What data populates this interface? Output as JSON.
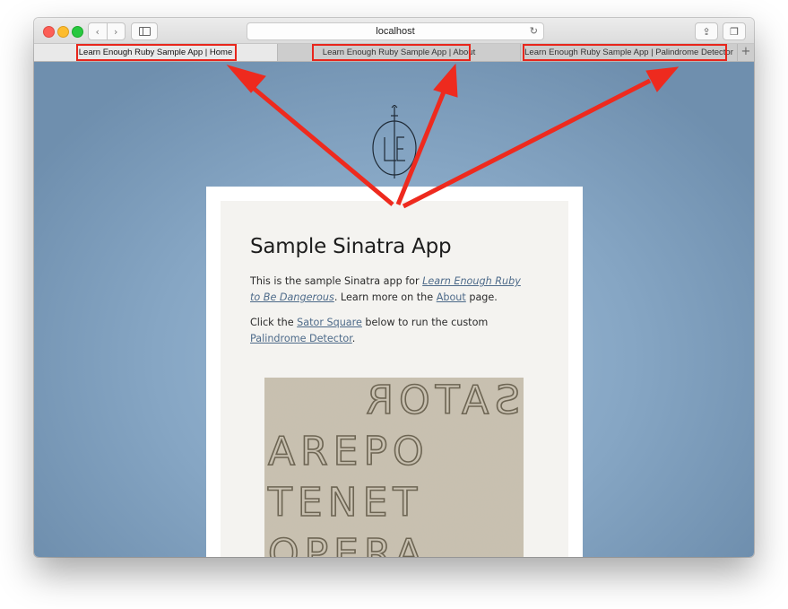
{
  "browser": {
    "url": "localhost",
    "tabs": [
      {
        "title": "Learn Enough Ruby Sample App | Home",
        "active": true
      },
      {
        "title": "Learn Enough Ruby Sample App | About",
        "active": false
      },
      {
        "title": "Learn Enough Ruby Sample App | Palindrome Detector",
        "active": false
      }
    ],
    "new_tab_label": "+"
  },
  "page": {
    "title": "Sample Sinatra App",
    "intro": {
      "prefix": "This is the sample Sinatra app for ",
      "book_link": "Learn Enough Ruby to Be Dangerous",
      "middle": ". Learn more on the ",
      "about_link": "About",
      "suffix": " page."
    },
    "cta": {
      "prefix": "Click the ",
      "sator_link": "Sator Square",
      "middle": " below to run the custom ",
      "palindrome_link": "Palindrome Detector",
      "suffix": "."
    },
    "sator_rows": [
      "SATOR",
      "AREPO",
      "TENET",
      "OPERA"
    ]
  },
  "colors": {
    "annotation": "#e8261c",
    "link": "#4e6b8a",
    "background": "#86a6c4"
  },
  "icons": [
    "back-icon",
    "forward-icon",
    "sidebar-icon",
    "reload-icon",
    "share-icon",
    "tabs-overview-icon",
    "le-logo"
  ]
}
